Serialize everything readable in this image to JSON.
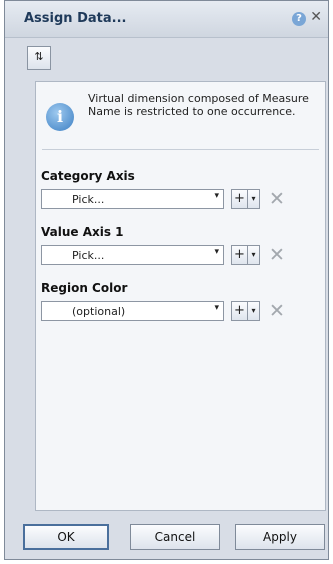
{
  "window": {
    "title": "Assign Data...",
    "help_glyph": "?",
    "close_glyph": "✕"
  },
  "toolbar": {
    "swap_glyph": "⇅"
  },
  "info": {
    "glyph": "i",
    "message": "Virtual dimension composed of Measure Name is restricted to one occurrence."
  },
  "sections": [
    {
      "label": "Category Axis",
      "value": "Pick...",
      "add_glyph": "+",
      "menu_glyph": "▾",
      "remove_glyph": "✕"
    },
    {
      "label": "Value Axis 1",
      "value": "Pick...",
      "add_glyph": "+",
      "menu_glyph": "▾",
      "remove_glyph": "✕"
    },
    {
      "label": "Region Color",
      "value": "(optional)",
      "add_glyph": "+",
      "menu_glyph": "▾",
      "remove_glyph": "✕"
    }
  ],
  "buttons": {
    "ok": "OK",
    "cancel": "Cancel",
    "apply": "Apply"
  },
  "colors": {
    "dialog_bg": "#d8dde6",
    "title_text": "#1f3a5a",
    "info_icon": "#3c7fc3"
  }
}
